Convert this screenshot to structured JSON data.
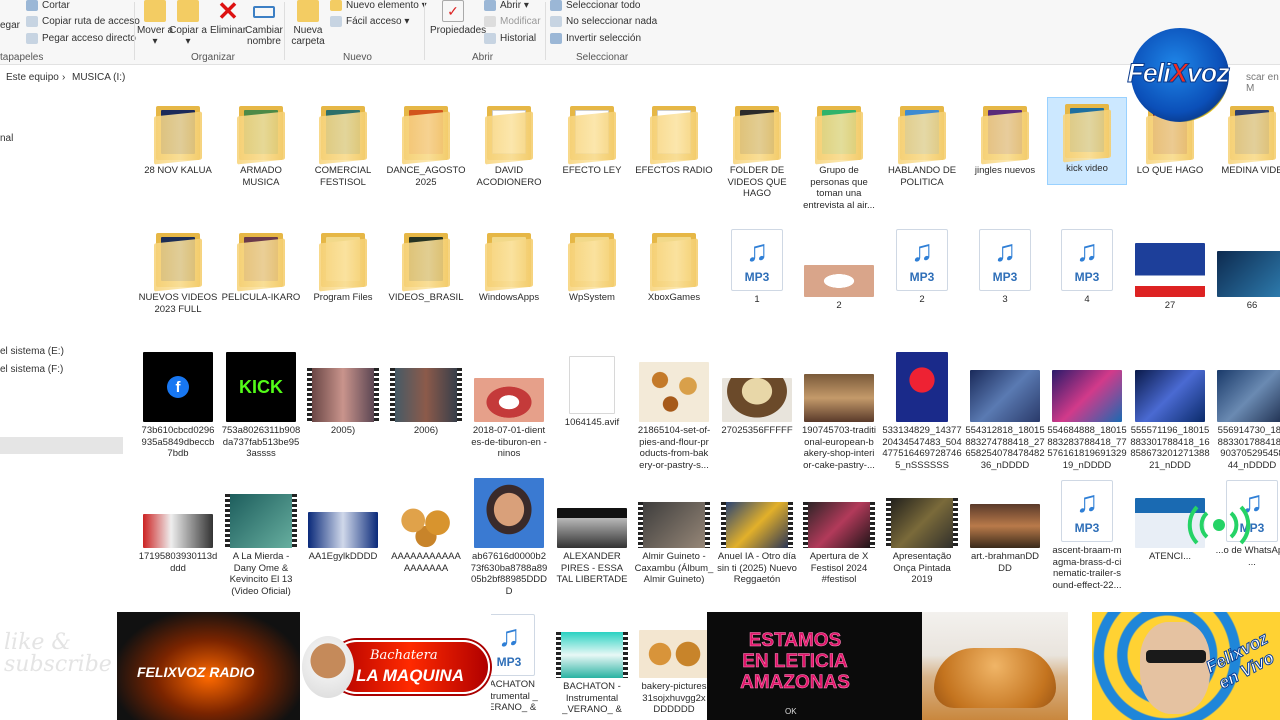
{
  "ribbon": {
    "clipboard": {
      "cut": "Cortar",
      "copy_path": "Copiar ruta de acceso",
      "paste_shortcut": "Pegar acceso directo",
      "paste_partial": "egar",
      "group_label": "tapapeles"
    },
    "organize": {
      "move_to": "Mover a ▾",
      "copy_to": "Copiar a ▾",
      "delete": "Eliminar",
      "rename": "Cambiar nombre",
      "group_label": "Organizar"
    },
    "new": {
      "new_folder": "Nueva carpeta",
      "new_item": "Nuevo elemento ▾",
      "easy_access": "Fácil acceso ▾",
      "group_label": "Nuevo"
    },
    "open": {
      "properties": "Propiedades",
      "open": "Abrir ▾",
      "edit": "Modificar",
      "history": "Historial",
      "group_label": "Abrir"
    },
    "select": {
      "select_all": "Seleccionar todo",
      "select_none": "No seleccionar nada",
      "invert": "Invertir selección",
      "group_label": "Seleccionar"
    }
  },
  "address": {
    "root": "Este equipo",
    "separator": "›",
    "current": "MUSICA (I:)",
    "search_partial": "scar en M"
  },
  "nav": {
    "item_nal": "nal",
    "item_e": "el sistema (E:)",
    "item_f": "el sistema (F:)"
  },
  "items": [
    {
      "label": "28 NOV KALUA"
    },
    {
      "label": "ARMADO MUSICA"
    },
    {
      "label": "COMERCIAL FESTISOL"
    },
    {
      "label": "DANCE_AGOSTO 2025"
    },
    {
      "label": "DAVID ACODIONERO"
    },
    {
      "label": "EFECTO LEY"
    },
    {
      "label": "EFECTOS RADIO"
    },
    {
      "label": "FOLDER DE VIDEOS QUE HAGO"
    },
    {
      "label": "Grupo de personas que toman una entrevista al air..."
    },
    {
      "label": "HABLANDO DE POLITICA"
    },
    {
      "label": "jingles nuevos"
    },
    {
      "label": "kick video"
    },
    {
      "label": "LO QUE HAGO"
    },
    {
      "label": "MEDINA VIDE"
    },
    {
      "label": "NUEVOS VIDEOS 2023 FULL"
    },
    {
      "label": "PELICULA-IKARO"
    },
    {
      "label": "Program Files"
    },
    {
      "label": "VIDEOS_BRASIL"
    },
    {
      "label": "WindowsApps"
    },
    {
      "label": "WpSystem"
    },
    {
      "label": "XboxGames"
    },
    {
      "label": "1"
    },
    {
      "label": "2"
    },
    {
      "label": "2"
    },
    {
      "label": "3"
    },
    {
      "label": "4"
    },
    {
      "label": "27"
    },
    {
      "label": "66"
    },
    {
      "label": "73b610cbcd0296 935a5849dbeccb 7bdb"
    },
    {
      "label": "753a8026311b908 da737fab513be95 3assss"
    },
    {
      "label": "2005)"
    },
    {
      "label": "2006)"
    },
    {
      "label": "2018-07-01-dient es-de-tiburon-en -ninos"
    },
    {
      "label": "1064145.avif"
    },
    {
      "label": "21865104-set-of- pies-and-flour-pr oducts-from-bak ery-or-pastry-s..."
    },
    {
      "label": "27025356FFFFF"
    },
    {
      "label": "190745703-traditi onal-european-b akery-shop-interi or-cake-pastry-..."
    },
    {
      "label": "533134829_14377 20434547483_504 477516469728746 5_nSSSSSS"
    },
    {
      "label": "554312818_18015 883274788418_27 658254078478482 36_nDDDD"
    },
    {
      "label": "554684888_18015 883283788418_77 576161819691329 19_nDDDD"
    },
    {
      "label": "555571196_18015 883301788418_16 858673201271388 21_nDDD"
    },
    {
      "label": "556914730_180 883301788418_ 903705295458 44_nDDDD"
    },
    {
      "label": "17195803930113d ddd"
    },
    {
      "label": "A La Mierda - Dany Ome & Kevincito El 13 (Video Oficial)"
    },
    {
      "label": "AA1EgylkDDDD"
    },
    {
      "label": "AAAAAAAAAAA AAAAAAA"
    },
    {
      "label": "ab67616d0000b2 73f630ba8788a89 05b2bf88985DDD D"
    },
    {
      "label": "ALEXANDER PIRES - ESSA TAL LIBERTADE"
    },
    {
      "label": "Almir Guineto - Caxambu (Álbum_ Almir Guineto)"
    },
    {
      "label": "Anuel IA - Otro día sin ti (2025) Nuevo Reggaetón"
    },
    {
      "label": "Apertura de X Festisol 2024 #festisol"
    },
    {
      "label": "Apresentação Onça Pintada 2019"
    },
    {
      "label": "art.-brahmanDD DD"
    },
    {
      "label": "ascent-braam-m agma-brass-d-ci nematic-trailer-s ound-effect-22..."
    },
    {
      "label": "ATENCI..."
    },
    {
      "label": "...o de WhatsApp ..."
    },
    {
      "label": "BACHATON nstrumental _ VERANO_ &"
    },
    {
      "label": "BACHATON - Instrumental _VERANO_ &"
    },
    {
      "label": "bakery-pictures 31sojxhuvgg2x DDDDDD"
    }
  ],
  "overlays": {
    "logo_left": "Feli",
    "logo_x": "X",
    "logo_right": "voz",
    "radio": "FELIXVOZ RADIO",
    "maquina_top": "Bachatera",
    "maquina_bottom": "LA MAQUINA",
    "leticia": "ESTAMOS EN LETICIA AMAZONAS",
    "leticia_ok": "OK",
    "live": "Felixvoz en Vivo",
    "watermark": "like & subscribe"
  }
}
